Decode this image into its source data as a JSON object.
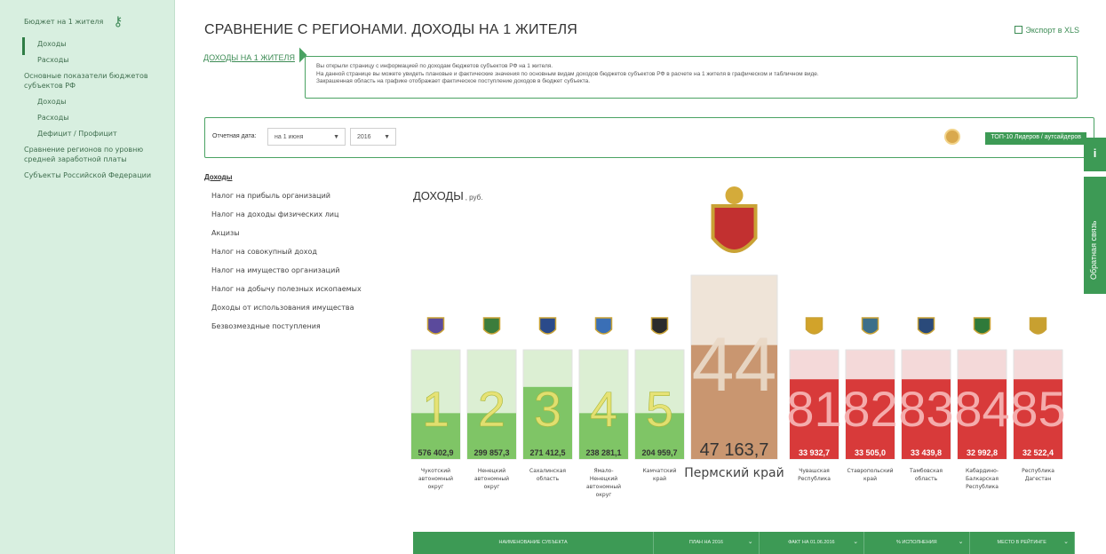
{
  "sidebar": {
    "items": [
      {
        "label": "Бюджет на 1 жителя",
        "level": 1
      },
      {
        "label": "Доходы",
        "level": 2
      },
      {
        "label": "Расходы",
        "level": 2
      },
      {
        "label": "Основные показатели бюджетов субъектов РФ",
        "level": 1
      },
      {
        "label": "Доходы",
        "level": 2
      },
      {
        "label": "Расходы",
        "level": 2
      },
      {
        "label": "Дефицит / Профицит",
        "level": 2
      },
      {
        "label": "Сравнение регионов по уровню средней заработной платы",
        "level": 1
      },
      {
        "label": "Субъекты Российской Федерации",
        "level": 1
      }
    ]
  },
  "header": {
    "title": "СРАВНЕНИЕ С РЕГИОНАМИ. ДОХОДЫ НА 1 ЖИТЕЛЯ",
    "export_label": "Экспорт в XLS"
  },
  "subtab": "ДОХОДЫ НА 1 ЖИТЕЛЯ",
  "info": {
    "lines": [
      "Вы открыли страницу с информацией по доходам бюджетов субъектов РФ на 1 жителя.",
      "На данной странице вы можете увидеть плановые и фактические значения по основным видам доходов бюджетов субъектов РФ в расчете на 1 жителя в графическом и табличном виде.",
      "Закрашенная область на графике отображает фактическое поступление доходов в бюджет субъекта."
    ]
  },
  "filters": {
    "label": "Отчетная дата:",
    "month": "на 1 июня",
    "year": "2016",
    "top10": "ТОП-10 Лидеров / аутсайдеров"
  },
  "categories": {
    "title": "Доходы",
    "items": [
      "Налог на прибыль организаций",
      "Налог на доходы физических лиц",
      "Акцизы",
      "Налог на совокупный доход",
      "Налог на имущество организаций",
      "Налог на добычу полезных ископаемых",
      "Доходы от использования имущества",
      "Безвозмездные поступления"
    ]
  },
  "chart_data": {
    "type": "bar",
    "title": "ДОХОДЫ",
    "unit": ", руб.",
    "bars": [
      {
        "rank": "1",
        "value": "576 402,9",
        "fill": 0.42,
        "region": [
          "Чукотский",
          "автономный",
          "округ"
        ],
        "group": "top",
        "emblem": "#5b4a9c"
      },
      {
        "rank": "2",
        "value": "299 857,3",
        "fill": 0.42,
        "region": [
          "Ненецкий",
          "автономный",
          "округ"
        ],
        "group": "top",
        "emblem": "#3c7d3c"
      },
      {
        "rank": "3",
        "value": "271 412,5",
        "fill": 0.66,
        "region": [
          "Сахалинская",
          "область"
        ],
        "group": "top",
        "emblem": "#2a4a8a"
      },
      {
        "rank": "4",
        "value": "238 281,1",
        "fill": 0.42,
        "region": [
          "Ямало-",
          "Ненецкий",
          "автономный",
          "округ"
        ],
        "group": "top",
        "emblem": "#3a6fb6"
      },
      {
        "rank": "5",
        "value": "204 959,7",
        "fill": 0.42,
        "region": [
          "Камчатский",
          "край"
        ],
        "group": "top",
        "emblem": "#2c2c2c"
      },
      {
        "rank": "44",
        "value": "47 163,7",
        "fill": 0.62,
        "region": [
          "Пермский край"
        ],
        "group": "self",
        "emblem": "#c23030"
      },
      {
        "rank": "81",
        "value": "33 932,7",
        "fill": 0.73,
        "region": [
          "Чувашская",
          "Республика"
        ],
        "group": "bottom",
        "emblem": "#d2a32a"
      },
      {
        "rank": "82",
        "value": "33 505,0",
        "fill": 0.73,
        "region": [
          "Ставропольский",
          "край"
        ],
        "group": "bottom",
        "emblem": "#3c6f8a"
      },
      {
        "rank": "83",
        "value": "33 439,8",
        "fill": 0.73,
        "region": [
          "Тамбовская",
          "область"
        ],
        "group": "bottom",
        "emblem": "#2a4a7a"
      },
      {
        "rank": "84",
        "value": "32 992,8",
        "fill": 0.73,
        "region": [
          "Кабардино-",
          "Балкарская",
          "Республика"
        ],
        "group": "bottom",
        "emblem": "#2f7a3a"
      },
      {
        "rank": "85",
        "value": "32 522,4",
        "fill": 0.73,
        "region": [
          "Республика",
          "Дагестан"
        ],
        "group": "bottom",
        "emblem": "#c8a030"
      }
    ]
  },
  "table": {
    "headers": [
      "НАИМЕНОВАНИЕ СУБЪЕКТА",
      "ПЛАН НА 2016",
      "ФАКТ НА 01.06.2016",
      "% ИСПОЛНЕНИЯ",
      "МЕСТО В РЕЙТИНГЕ"
    ]
  },
  "side_tabs": {
    "info_icon": "i",
    "feedback": "Обратная связь"
  },
  "colors": {
    "green": "#3d9a55",
    "sidebar": "#d8efe0",
    "bar_green": "#7fc566",
    "bar_red": "#d83a3a",
    "bar_self": "#c99670"
  }
}
